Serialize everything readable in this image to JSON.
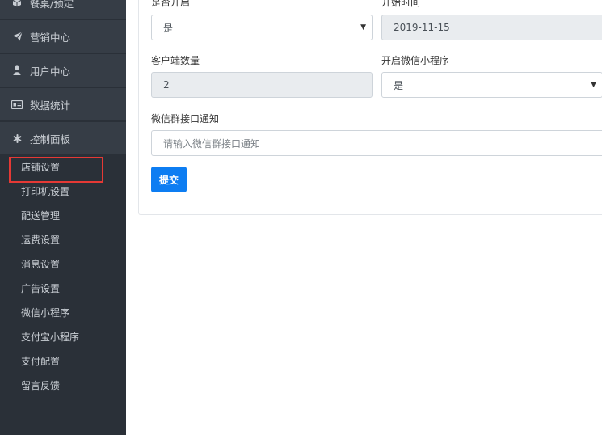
{
  "sidebar": {
    "nav": [
      {
        "label": "餐桌/预定",
        "icon": "cube-icon"
      },
      {
        "label": "营销中心",
        "icon": "send-icon"
      },
      {
        "label": "用户中心",
        "icon": "user-icon"
      },
      {
        "label": "数据统计",
        "icon": "id-card-icon"
      },
      {
        "label": "控制面板",
        "icon": "asterisk-icon"
      }
    ],
    "submenu": [
      {
        "label": "店铺设置"
      },
      {
        "label": "打印机设置"
      },
      {
        "label": "配送管理"
      },
      {
        "label": "运费设置"
      },
      {
        "label": "消息设置"
      },
      {
        "label": "广告设置"
      },
      {
        "label": "微信小程序"
      },
      {
        "label": "支付宝小程序"
      },
      {
        "label": "支付配置"
      },
      {
        "label": "留言反馈"
      }
    ]
  },
  "form": {
    "enabled": {
      "label": "是否开启",
      "value": "是"
    },
    "start_time": {
      "label": "开始时间",
      "value": "2019-11-15"
    },
    "client_count": {
      "label": "客户端数量",
      "value": "2"
    },
    "wechat_miniprogram": {
      "label": "开启微信小程序",
      "value": "是"
    },
    "wechat_group_notice": {
      "label": "微信群接口通知",
      "placeholder": "请输入微信群接口通知"
    },
    "submit_label": "提交"
  }
}
